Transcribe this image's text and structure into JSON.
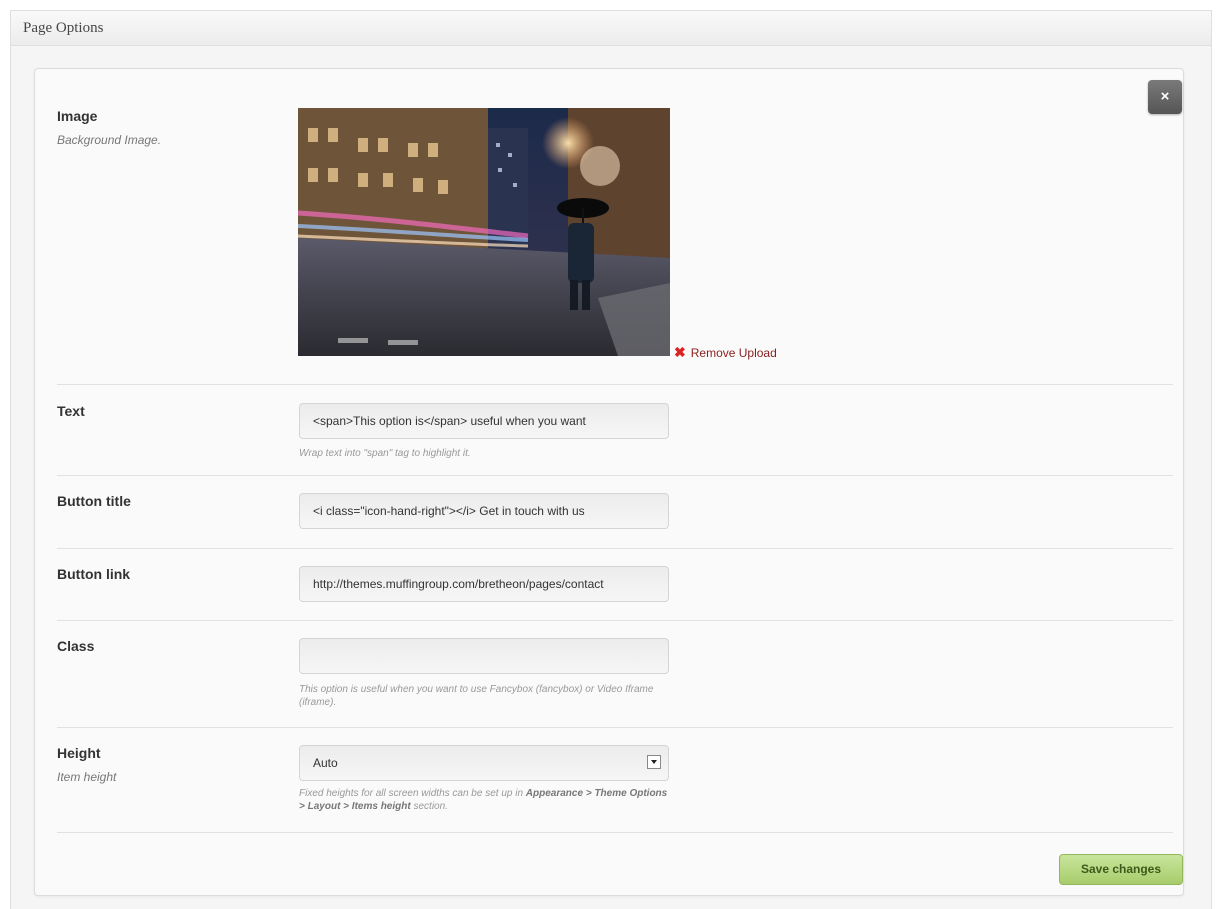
{
  "metabox": {
    "title": "Page Options"
  },
  "close": {
    "label": "×"
  },
  "fields": {
    "image": {
      "label": "Image",
      "description": "Background Image.",
      "remove_label": "Remove Upload"
    },
    "text": {
      "label": "Text",
      "value": "<span>This option is</span> useful when you want",
      "help": "Wrap text into \"span\" tag to highlight it."
    },
    "button_title": {
      "label": "Button title",
      "value": "<i class=\"icon-hand-right\"></i> Get in touch with us"
    },
    "button_link": {
      "label": "Button link",
      "value": "http://themes.muffingroup.com/bretheon/pages/contact"
    },
    "class": {
      "label": "Class",
      "value": "",
      "help": "This option is useful when you want to use Fancybox (fancybox) or Video Iframe (iframe)."
    },
    "height": {
      "label": "Height",
      "description": "Item height",
      "selected": "Auto",
      "help_pre": "Fixed heights for all screen widths can be set up in ",
      "help_bold": "Appearance > Theme Options > Layout > Items height",
      "help_post": " section."
    }
  },
  "save": {
    "label": "Save changes"
  },
  "colors": {
    "save_button": "#b5d77f",
    "remove_link": "#8b1e1e",
    "close_button": "#666666"
  },
  "icons": {
    "close": "close-icon",
    "remove": "remove-x-icon",
    "select": "chevron-down-icon"
  }
}
